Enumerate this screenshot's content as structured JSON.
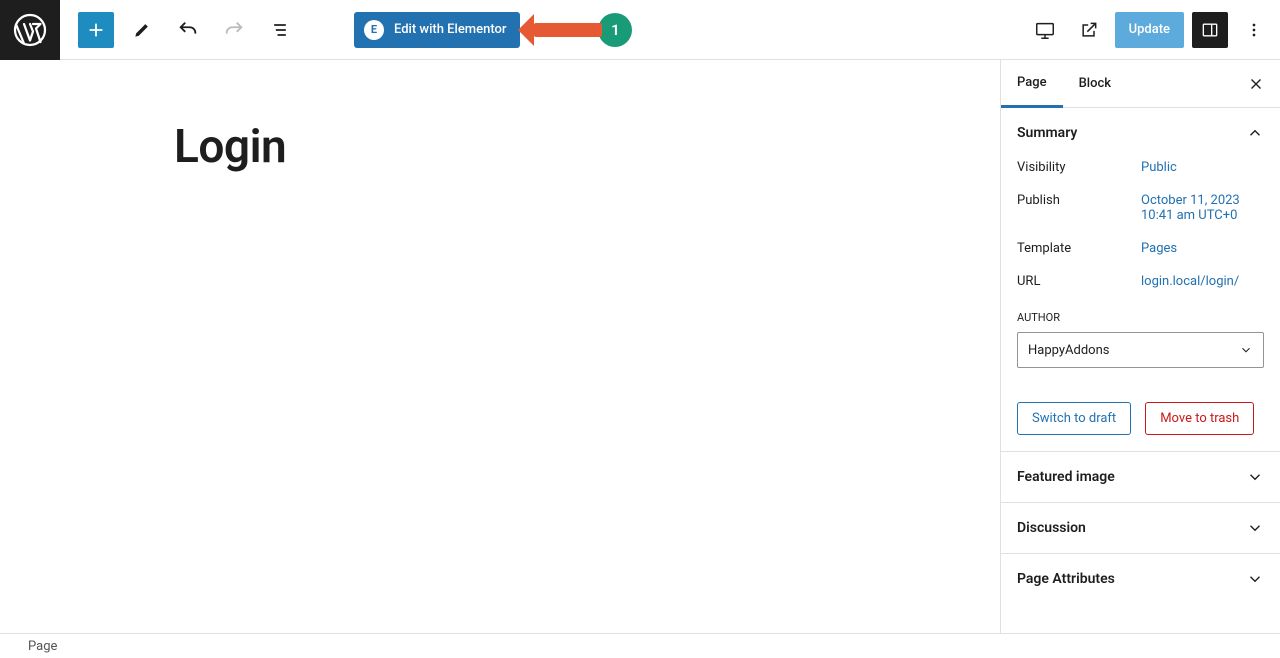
{
  "toolbar": {
    "elementor_label": "Edit with Elementor",
    "update_label": "Update",
    "annotation_number": "1"
  },
  "canvas": {
    "title": "Login"
  },
  "sidebar": {
    "tabs": {
      "page": "Page",
      "block": "Block"
    },
    "sections": {
      "summary": "Summary",
      "featured_image": "Featured image",
      "discussion": "Discussion",
      "page_attributes": "Page Attributes"
    },
    "summary": {
      "visibility": {
        "label": "Visibility",
        "value": "Public"
      },
      "publish": {
        "label": "Publish",
        "value": "October 11, 2023 10:41 am UTC+0"
      },
      "template": {
        "label": "Template",
        "value": "Pages"
      },
      "url": {
        "label": "URL",
        "value": "login.local/login/"
      },
      "author": {
        "label": "AUTHOR",
        "value": "HappyAddons"
      },
      "switch_label": "Switch to draft",
      "trash_label": "Move to trash"
    }
  },
  "footer": {
    "breadcrumb": "Page"
  }
}
